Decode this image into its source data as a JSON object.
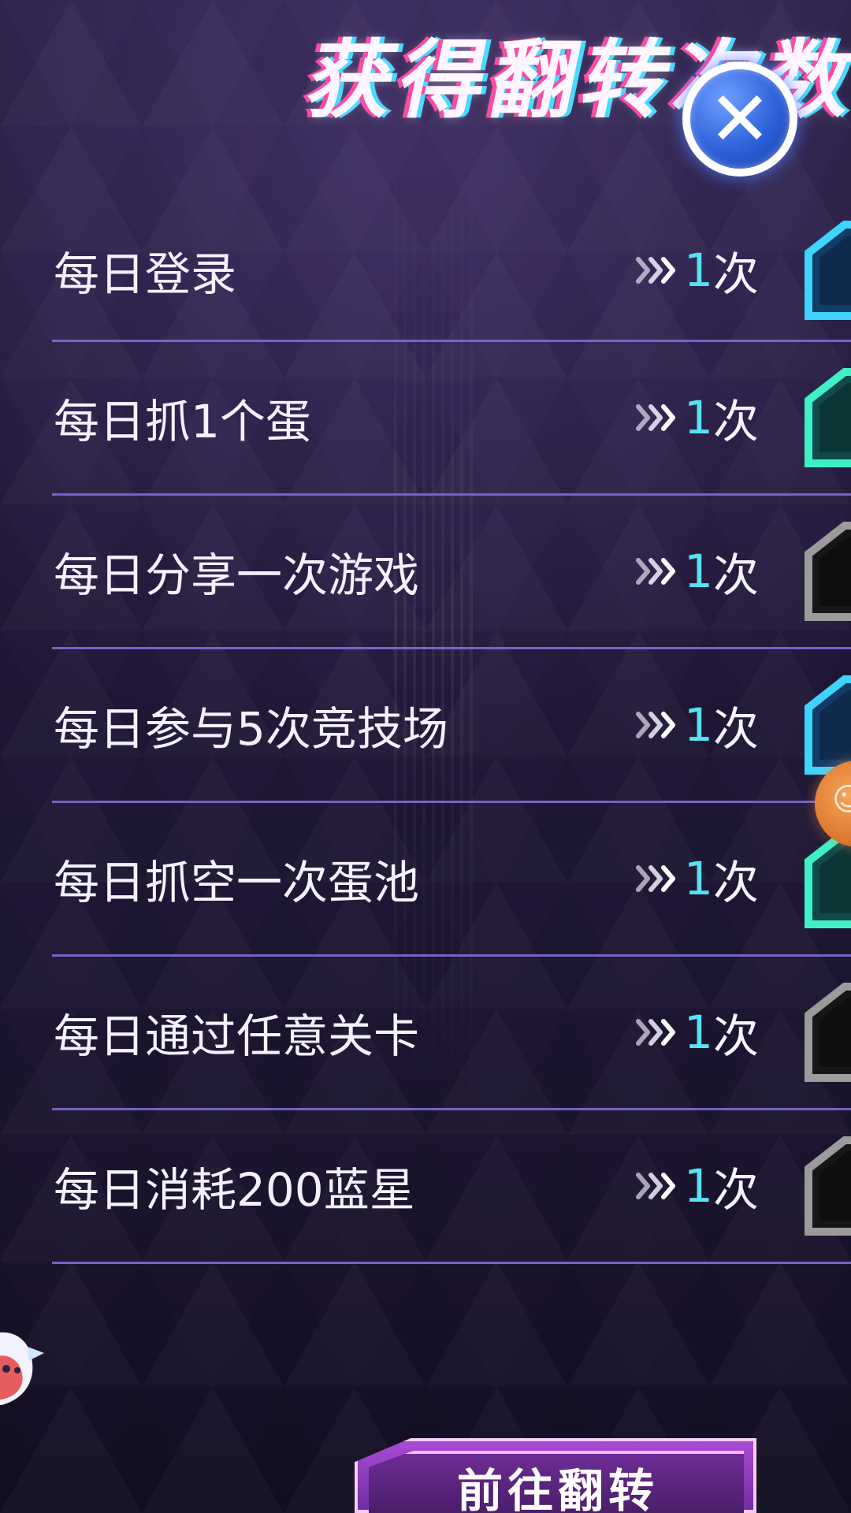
{
  "header": {
    "title_top": "",
    "title_main": "获得翻转次数"
  },
  "tasks": [
    {
      "label": "每日登录",
      "reward_number": "1",
      "reward_unit": "次",
      "badge_color": "#3fd3ff"
    },
    {
      "label": "每日抓1个蛋",
      "reward_number": "1",
      "reward_unit": "次",
      "badge_color": "#3ff0c6"
    },
    {
      "label": "每日分享一次游戏",
      "reward_number": "1",
      "reward_unit": "次",
      "badge_color": "#9b9b9b"
    },
    {
      "label": "每日参与5次竞技场",
      "reward_number": "1",
      "reward_unit": "次",
      "badge_color": "#3fd3ff"
    },
    {
      "label": "每日抓空一次蛋池",
      "reward_number": "1",
      "reward_unit": "次",
      "badge_color": "#3ff0c6"
    },
    {
      "label": "每日通过任意关卡",
      "reward_number": "1",
      "reward_unit": "次",
      "badge_color": "#9b9b9b"
    },
    {
      "label": "每日消耗200蓝星",
      "reward_number": "1",
      "reward_unit": "次",
      "badge_color": "#9b9b9b"
    }
  ],
  "buttons": {
    "close_icon": "close-icon",
    "cta_label": "前往翻转"
  },
  "colors": {
    "accent_cyan": "#57e2f4",
    "divider": "#7562c9",
    "close_blue": "#2d60d9",
    "cta_purple": "#8e38c0",
    "background": "#221a3b"
  },
  "icons": {
    "close": "close-icon",
    "arrows": "chevrons-right-icon",
    "row_badge": "hexagon-badge-icon",
    "mascot": "mascot-icon",
    "floating_orb": "floating-assistant-icon"
  }
}
